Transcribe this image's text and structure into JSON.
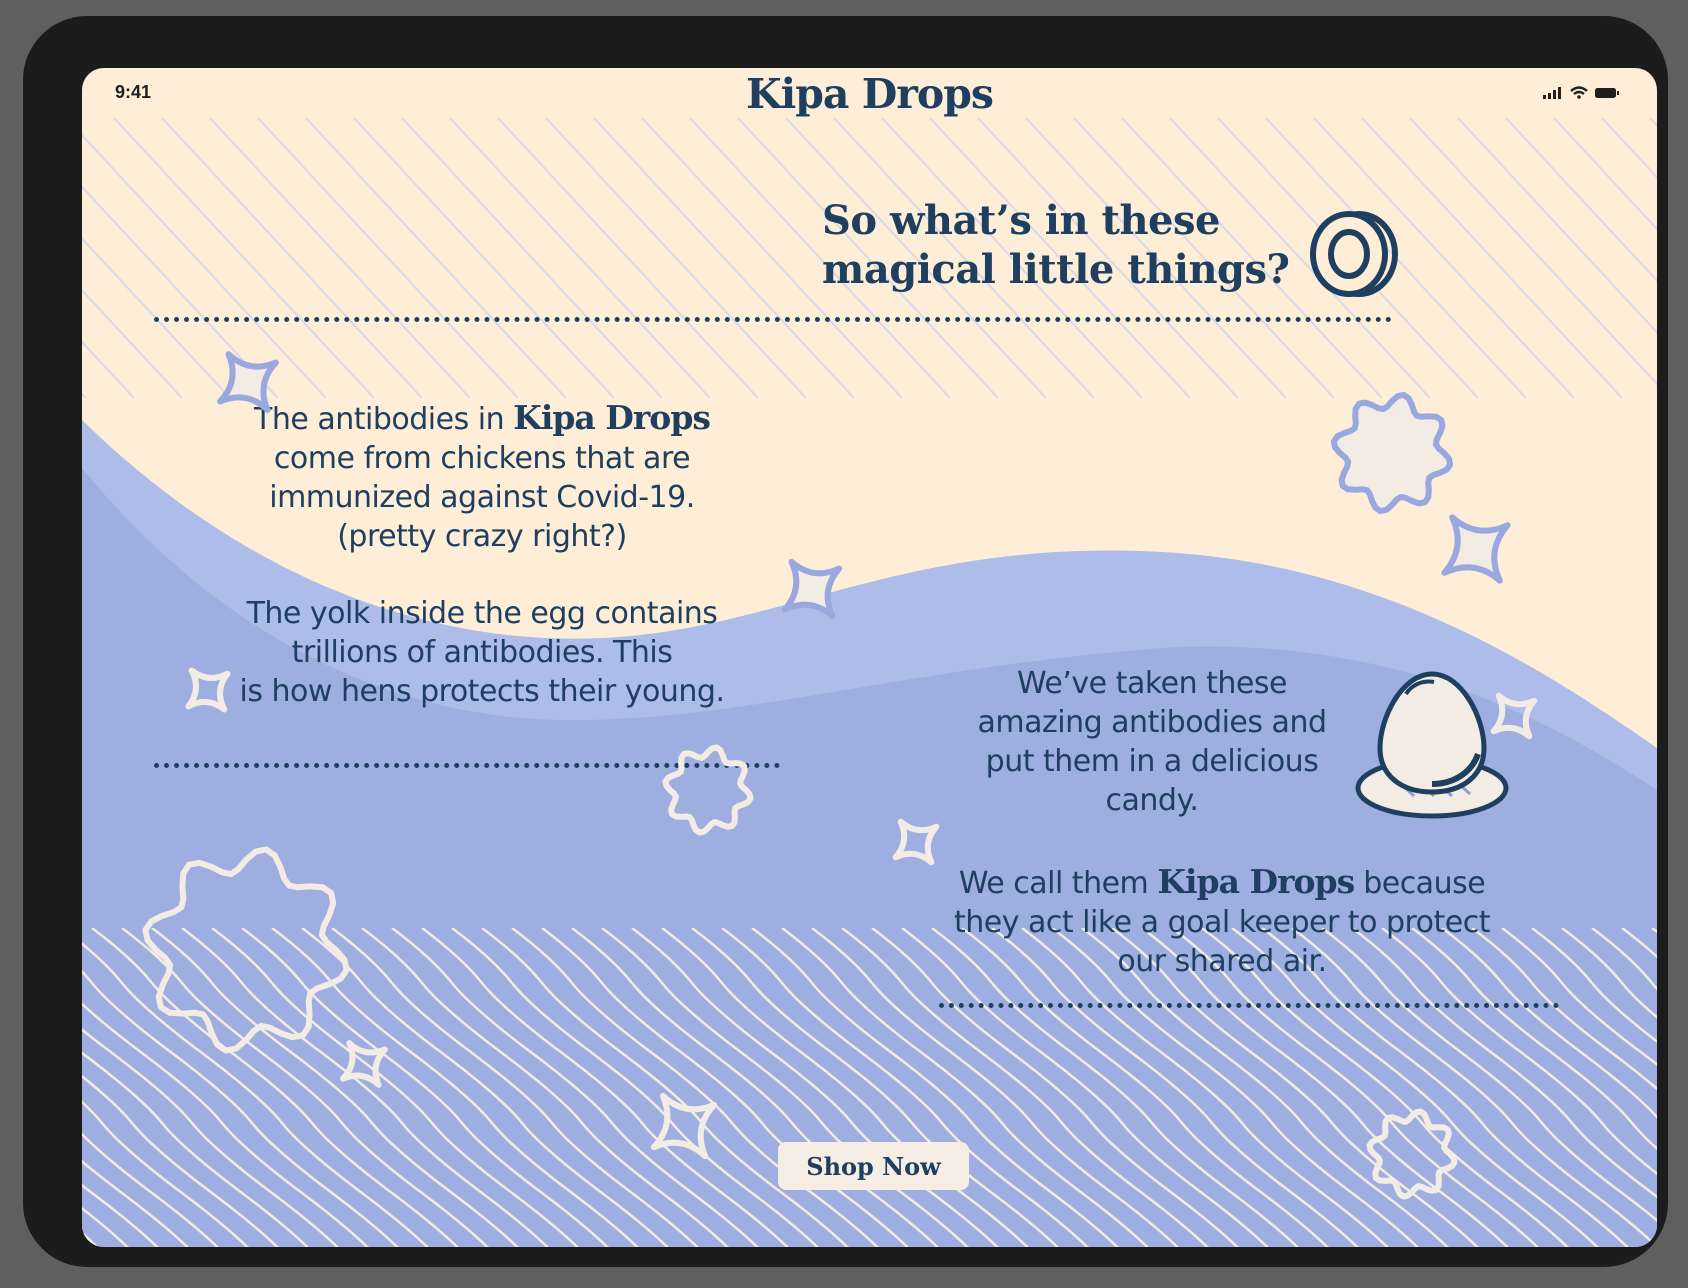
{
  "status_bar": {
    "time": "9:41"
  },
  "brand": {
    "name": "Kipa Drops"
  },
  "headline": {
    "line1": "So what’s in these",
    "line2": "magical little things?"
  },
  "section1": {
    "p1_prefix": "The antibodies in ",
    "p1_brand": "Kipa Drops",
    "p1_line2": "come from chickens that are",
    "p1_line3": "immunized against Covid-19.",
    "p1_line4": "(pretty crazy right?)",
    "p2_line1": "The yolk inside the egg contains",
    "p2_line2": "trillions of antibodies. This",
    "p2_line3": "is how hens protects their young."
  },
  "section2": {
    "p1_line1": "We’ve taken these",
    "p1_line2": "amazing antibodies and",
    "p1_line3": "put them in a delicious",
    "p1_line4": "candy.",
    "p2_prefix": "We call them ",
    "p2_brand": "Kipa Drops",
    "p2_suffix": " because",
    "p2_line2": "they act like a goal keeper to protect",
    "p2_line3": "our shared air."
  },
  "cta": {
    "label": "Shop Now"
  },
  "colors": {
    "navy": "#1e3f60",
    "cream": "#feeed8",
    "periwinkle": "#9eaee0",
    "light_periwinkle": "#adbce8",
    "off_white": "#f3ece4"
  },
  "icons": [
    "signal-icon",
    "wifi-icon",
    "battery-icon",
    "candy-drop-icon",
    "egg-on-nest-icon",
    "sparkle-star-icon",
    "wavy-blob-icon"
  ]
}
